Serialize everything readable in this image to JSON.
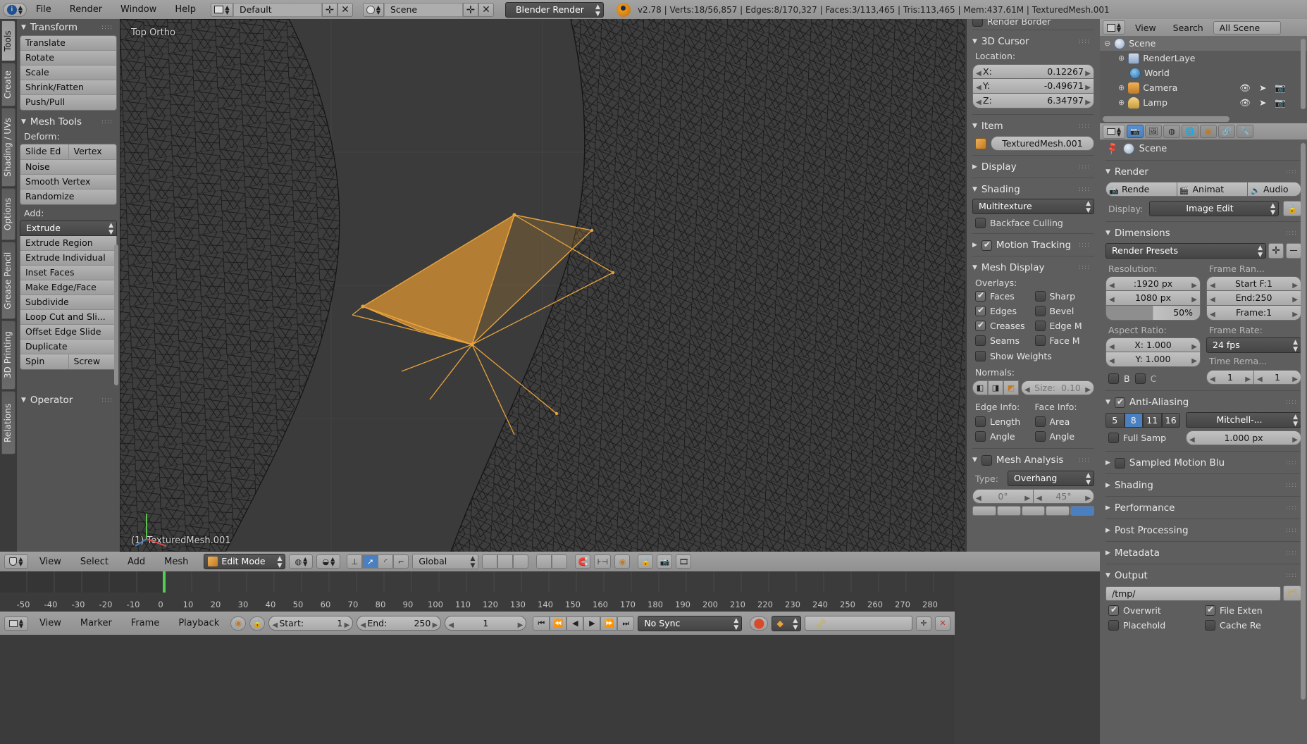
{
  "topbar": {
    "menus": [
      "File",
      "Render",
      "Window",
      "Help"
    ],
    "screen_layout": "Default",
    "scene_name": "Scene",
    "engine": "Blender Render",
    "status": "v2.78 | Verts:18/56,857 | Edges:8/170,327 | Faces:3/113,465 | Tris:113,465 | Mem:437.61M | TexturedMesh.001",
    "icons": {
      "info": "info-icon",
      "layout": "screen-layout-icon",
      "add": "add-icon",
      "remove": "remove-icon",
      "scene": "scene-icon",
      "blender": "blender-logo-icon"
    }
  },
  "toolshelf": {
    "tabs": [
      "Tools",
      "Create",
      "Shading / UVs",
      "Options",
      "Grease Pencil",
      "3D Printing",
      "Relations"
    ],
    "active_tab": "Tools",
    "panels": [
      {
        "title": "Transform",
        "open": true,
        "buttons": [
          "Translate",
          "Rotate",
          "Scale",
          "Shrink/Fatten",
          "Push/Pull"
        ]
      },
      {
        "title": "Mesh Tools",
        "open": true,
        "deform_label": "Deform:",
        "deform_pair": [
          "Slide Ed",
          "Vertex"
        ],
        "deform_buttons": [
          "Noise",
          "Smooth Vertex",
          "Randomize"
        ],
        "add_label": "Add:",
        "add_dropdown": "Extrude",
        "add_buttons": [
          "Extrude Region",
          "Extrude Individual",
          "Inset Faces",
          "Make Edge/Face",
          "Subdivide",
          "Loop Cut and Sli...",
          "Offset Edge Slide",
          "Duplicate"
        ],
        "spin_pair": [
          "Spin",
          "Screw"
        ]
      }
    ],
    "operator_panel": {
      "title": "Operator",
      "open": true
    }
  },
  "viewport": {
    "view_label": "Top Ortho",
    "object_label": "(1) TexturedMesh.001",
    "axis_gizmo": {
      "x": "X",
      "y": "Y",
      "z": "Z"
    },
    "selection_color": "#e8a33d",
    "face_fill_color": "#c98a34"
  },
  "npanel": {
    "render_border_label": "Render Border",
    "cursor": {
      "title": "3D Cursor",
      "location_label": "Location:",
      "fields": [
        {
          "label": "X:",
          "value": "0.12267"
        },
        {
          "label": "Y:",
          "value": "-0.49671"
        },
        {
          "label": "Z:",
          "value": "6.34797"
        }
      ]
    },
    "item": {
      "title": "Item",
      "name": "TexturedMesh.001",
      "icon": "mesh-object-icon"
    },
    "display": {
      "title": "Display",
      "open": false
    },
    "shading": {
      "title": "Shading",
      "mode": "Multitexture",
      "backface_culling": {
        "label": "Backface Culling",
        "checked": false
      }
    },
    "motion_tracking": {
      "title": "Motion Tracking",
      "checked": true,
      "open": false
    },
    "mesh_display": {
      "title": "Mesh Display",
      "overlays_label": "Overlays:",
      "overlays": [
        {
          "label": "Faces",
          "checked": true
        },
        {
          "label": "Sharp",
          "checked": false
        },
        {
          "label": "Edges",
          "checked": true
        },
        {
          "label": "Bevel",
          "checked": false
        },
        {
          "label": "Creases",
          "checked": true
        },
        {
          "label": "Edge M",
          "checked": false
        },
        {
          "label": "Seams",
          "checked": false
        },
        {
          "label": "Face M",
          "checked": false
        }
      ],
      "show_weights": {
        "label": "Show Weights",
        "checked": false
      },
      "normals_label": "Normals:",
      "normals_size": {
        "label": "Size:",
        "value": "0.10"
      },
      "edge_info_label": "Edge Info:",
      "face_info_label": "Face Info:",
      "edge_info": [
        {
          "label": "Length",
          "checked": false
        },
        {
          "label": "Angle",
          "checked": false
        }
      ],
      "face_info": [
        {
          "label": "Area",
          "checked": false
        },
        {
          "label": "Angle",
          "checked": false
        }
      ]
    },
    "mesh_analysis": {
      "title": "Mesh Analysis",
      "checked": false,
      "type_label": "Type:",
      "type_value": "Overhang",
      "min_angle": "0°",
      "max_angle": "45°"
    }
  },
  "viewport_footer": {
    "menus": [
      "View",
      "Select",
      "Add",
      "Mesh"
    ],
    "mode": "Edit Mode",
    "transform_orientation": "Global",
    "icons": [
      "editor-type-icon",
      "viewport-shading-icon",
      "pivot-icon",
      "vertex-select-icon",
      "edge-select-icon",
      "face-select-icon",
      "snap-magnet-icon",
      "proportional-edit-icon",
      "occlude-icon",
      "camera-lock-icon",
      "render-opengl-icon",
      "render-opengl-anim-icon"
    ]
  },
  "timeline": {
    "ruler_ticks": [
      "-50",
      "-40",
      "-30",
      "-20",
      "-10",
      "0",
      "10",
      "20",
      "30",
      "40",
      "50",
      "60",
      "70",
      "80",
      "90",
      "100",
      "110",
      "120",
      "130",
      "140",
      "150",
      "160",
      "170",
      "180",
      "190",
      "200",
      "210",
      "220",
      "230",
      "240",
      "250",
      "260",
      "270",
      "280"
    ],
    "playhead_frame": 1,
    "menus": [
      "View",
      "Marker",
      "Frame",
      "Playback"
    ],
    "start_label": "Start:",
    "start_value": "1",
    "end_label": "End:",
    "end_value": "250",
    "current_frame": "1",
    "sync_mode": "No Sync",
    "icons": [
      "editor-type-icon",
      "auto-key-icon",
      "lock-icon",
      "record-icon",
      "keyframe-type-icon",
      "keying-set-icon",
      "jump-start-icon",
      "prev-keyframe-icon",
      "play-reverse-icon",
      "play-icon",
      "next-keyframe-icon",
      "jump-end-icon"
    ]
  },
  "outliner": {
    "header_menus": [
      "View",
      "Search"
    ],
    "display_mode": "All Scene",
    "icons": {
      "editor": "outliner-icon"
    },
    "rows": [
      {
        "name": "Scene",
        "icon": "scene-icon",
        "depth": 0,
        "selected": true,
        "expander": "⊖"
      },
      {
        "name": "RenderLaye",
        "icon": "renderlayers-icon",
        "depth": 1,
        "selected": false,
        "expander": "⊕"
      },
      {
        "name": "World",
        "icon": "world-icon",
        "depth": 1,
        "selected": false,
        "expander": ""
      },
      {
        "name": "Camera",
        "icon": "camera-icon",
        "depth": 1,
        "selected": false,
        "expander": "⊕"
      },
      {
        "name": "Lamp",
        "icon": "lamp-icon",
        "depth": 1,
        "selected": false,
        "expander": "⊕"
      }
    ]
  },
  "properties": {
    "breadcrumb": "Scene",
    "pin_icon": "pin-icon",
    "tabs": [
      "render-tab",
      "renderlayers-tab",
      "scene-tab",
      "world-tab",
      "object-tab",
      "constraints-tab",
      "modifiers-tab"
    ],
    "active_tab": "render-tab",
    "render": {
      "title": "Render",
      "buttons": [
        "Rende",
        "Animat",
        "Audio"
      ],
      "display_label": "Display:",
      "display_value": "Image Edit"
    },
    "dimensions": {
      "title": "Dimensions",
      "presets": "Render Presets",
      "resolution_label": "Resolution:",
      "res_x": ":1920 px",
      "res_y": "1080 px",
      "res_percent": "50%",
      "frame_range_label": "Frame Ran...",
      "start_frame": "Start F:1",
      "end_frame": "End:250",
      "frame_step": "Frame:1",
      "aspect_label": "Aspect Ratio:",
      "aspect_x": "X: 1.000",
      "aspect_y": "Y: 1.000",
      "border_label": "B",
      "crop_label": "C",
      "frame_rate_label": "Frame Rate:",
      "frame_rate": "24 fps",
      "time_remap_label": "Time Rema...",
      "remap_old": "1",
      "remap_new": "1"
    },
    "antialiasing": {
      "title": "Anti-Aliasing",
      "checked": true,
      "samples": [
        "5",
        "8",
        "11",
        "16"
      ],
      "active_sample": "8",
      "filter": "Mitchell-...",
      "full_sample": {
        "label": "Full Samp",
        "checked": false
      },
      "filter_size": "1.000 px"
    },
    "collapsed_panels": [
      {
        "title": "Sampled Motion Blu",
        "has_checkbox": true
      },
      {
        "title": "Shading",
        "has_checkbox": false
      },
      {
        "title": "Performance",
        "has_checkbox": false
      },
      {
        "title": "Post Processing",
        "has_checkbox": false
      },
      {
        "title": "Metadata",
        "has_checkbox": false
      }
    ],
    "output": {
      "title": "Output",
      "path": "/tmp/",
      "folder_icon": "folder-icon",
      "checks": [
        {
          "label": "Overwrit",
          "checked": true
        },
        {
          "label": "File Exten",
          "checked": true
        },
        {
          "label": "Placehold",
          "checked": false
        },
        {
          "label": "Cache Re",
          "checked": false
        }
      ]
    }
  },
  "colors": {
    "accent_blue": "#4a7fc0",
    "selection_orange": "#e8a33d",
    "panel_bg": "#5e5e5e",
    "header_bg": "#999999",
    "viewport_bg": "#3b3b3b"
  }
}
